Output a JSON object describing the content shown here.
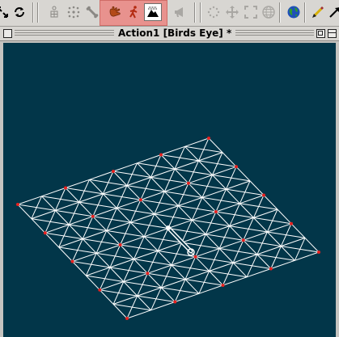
{
  "window": {
    "title": "Action1 [Birds Eye] *"
  },
  "toolbar": {
    "buttons": [
      {
        "icon": "fit-arrows-icon"
      },
      {
        "icon": "refresh-icon"
      },
      {
        "icon": "figure-grid-icon"
      },
      {
        "icon": "dots-square-icon"
      },
      {
        "icon": "bone-icon"
      },
      {
        "icon": "hand-grab-icon",
        "state": "highlighted"
      },
      {
        "icon": "walking-figure-icon",
        "state": "highlighted"
      },
      {
        "icon": "terrain-icon",
        "state": "active"
      },
      {
        "icon": "megaphone-icon"
      },
      {
        "icon": "select-dots-icon"
      },
      {
        "icon": "move-cross-icon"
      },
      {
        "icon": "corners-icon"
      },
      {
        "icon": "globe-icon"
      },
      {
        "icon": "earth-icon"
      },
      {
        "icon": "pencil-icon"
      },
      {
        "icon": "diagonal-arrow-icon"
      }
    ],
    "highlight_color": "#e8928e"
  },
  "viewport": {
    "view": "Birds Eye",
    "background": "#023649",
    "grid": {
      "rows": 8,
      "cols": 8,
      "line_color": "#ffffff",
      "vertex_color": "#e8211f"
    }
  }
}
